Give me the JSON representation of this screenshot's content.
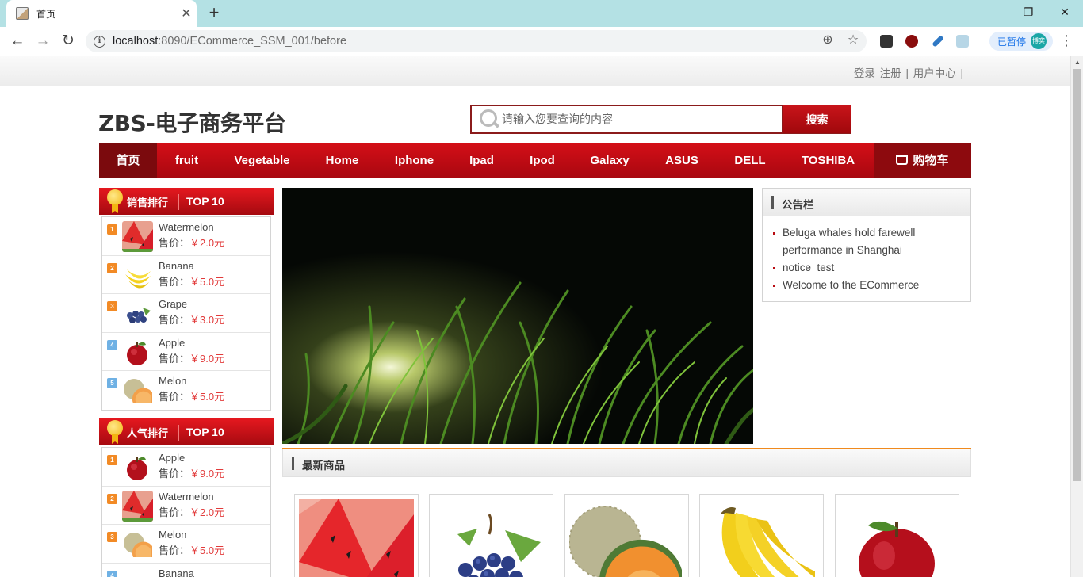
{
  "browser": {
    "tab_title": "首页",
    "url_host": "localhost",
    "url_rest": ":8090/ECommerce_SSM_001/before",
    "paused_label": "已暂停",
    "profile_initials": "博实"
  },
  "top_links": {
    "login": "登录",
    "register": "注册",
    "divider": "|",
    "user_center": "用户中心"
  },
  "site": {
    "logo": "ZBS-电子商务平台"
  },
  "search": {
    "placeholder": "请输入您要查询的内容",
    "button": "搜索"
  },
  "nav": {
    "items": [
      "首页",
      "fruit",
      "Vegetable",
      "Home",
      "Iphone",
      "Ipad",
      "Ipod",
      "Galaxy",
      "ASUS",
      "DELL",
      "TOSHIBA"
    ],
    "cart": "购物车"
  },
  "sales_rank": {
    "title": "销售排行",
    "top": "TOP 10",
    "price_label": "售价：",
    "items": [
      {
        "rank": "1",
        "name": "Watermelon",
        "price": "￥2.0元"
      },
      {
        "rank": "2",
        "name": "Banana",
        "price": "￥5.0元"
      },
      {
        "rank": "3",
        "name": "Grape",
        "price": "￥3.0元"
      },
      {
        "rank": "4",
        "name": "Apple",
        "price": "￥9.0元"
      },
      {
        "rank": "5",
        "name": "Melon",
        "price": "￥5.0元"
      }
    ]
  },
  "popular_rank": {
    "title": "人气排行",
    "top": "TOP 10",
    "price_label": "售价：",
    "items": [
      {
        "rank": "1",
        "name": "Apple",
        "price": "￥9.0元"
      },
      {
        "rank": "2",
        "name": "Watermelon",
        "price": "￥2.0元"
      },
      {
        "rank": "3",
        "name": "Melon",
        "price": "￥5.0元"
      },
      {
        "rank": "4",
        "name": "Banana",
        "price": ""
      }
    ]
  },
  "notice": {
    "title": "公告栏",
    "items": [
      "Beluga whales hold farewell performance in Shanghai",
      "notice_test",
      "Welcome to the ECommerce"
    ]
  },
  "newest": {
    "title": "最新商品"
  },
  "colors": {
    "brand_red": "#c8141a",
    "dark_red": "#7b0a0d",
    "price_red": "#e23b3b",
    "accent_orange": "#f08a1d"
  }
}
